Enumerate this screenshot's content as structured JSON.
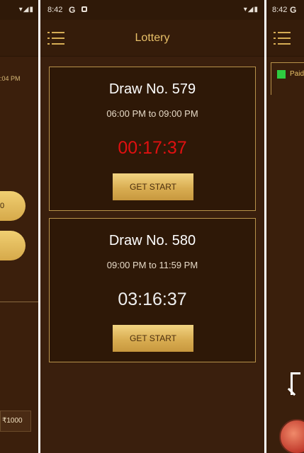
{
  "left_screen": {
    "time_text": ":04 PM",
    "pill_top": "0",
    "pill_bottom": "",
    "amount": "₹1000"
  },
  "center_screen": {
    "status": {
      "time": "8:42",
      "g": "G"
    },
    "header": {
      "title": "Lottery"
    },
    "draws": [
      {
        "title": "Draw No. 579",
        "time_range": "06:00 PM to 09:00 PM",
        "countdown": "00:17:37",
        "button": "GET START"
      },
      {
        "title": "Draw No. 580",
        "time_range": "09:00 PM to 11:59 PM",
        "countdown": "03:16:37",
        "button": "GET START"
      }
    ]
  },
  "right_screen": {
    "status": {
      "time": "8:42",
      "g": "G"
    },
    "paid_label": "Paid"
  },
  "colors": {
    "background": "#3a1f0d",
    "accent_gold": "#d9ad52",
    "title_gold": "#e8c068",
    "countdown_active": "#e01010"
  }
}
